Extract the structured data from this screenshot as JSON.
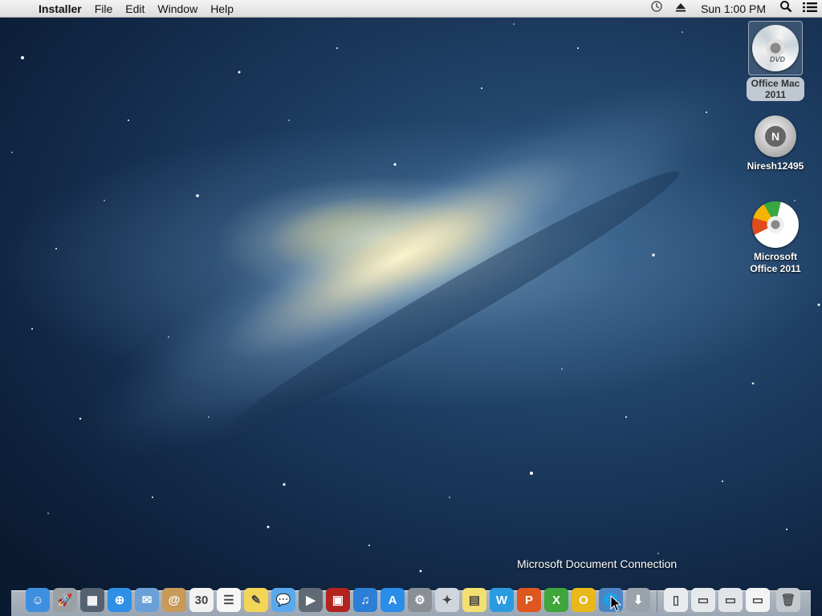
{
  "menubar": {
    "apple_glyph": "",
    "app_name": "Installer",
    "menus": [
      "File",
      "Edit",
      "Window",
      "Help"
    ],
    "clock": "Sun 1:00 PM",
    "status_icons": [
      "time-machine-icon",
      "eject-icon",
      "spotlight-search-icon",
      "notification-center-icon"
    ]
  },
  "desktop": {
    "icons": [
      {
        "label_line1": "Office Mac",
        "label_line2": "2011",
        "disc_text": "DVD",
        "selected": true
      },
      {
        "label": "Niresh12495",
        "badge": "N"
      },
      {
        "label_line1": "Microsoft",
        "label_line2": "Office 2011"
      }
    ]
  },
  "dock": {
    "tooltip": "Microsoft Document Connection",
    "items": [
      {
        "name": "finder-icon",
        "glyph": "☺",
        "bg": "#3d8fe0"
      },
      {
        "name": "launchpad-icon",
        "glyph": "🚀",
        "bg": "#9aa0a6"
      },
      {
        "name": "mission-control-icon",
        "glyph": "▦",
        "bg": "#556070"
      },
      {
        "name": "safari-icon",
        "glyph": "⊕",
        "bg": "#2f8fe6"
      },
      {
        "name": "mail-stamp-icon",
        "glyph": "✉",
        "bg": "#6aa0d8"
      },
      {
        "name": "contacts-icon",
        "glyph": "@",
        "bg": "#c79a5a"
      },
      {
        "name": "calendar-icon",
        "glyph": "30",
        "bg": "#f2f2f2"
      },
      {
        "name": "reminders-icon",
        "glyph": "☰",
        "bg": "#f7f7f7"
      },
      {
        "name": "notes-icon",
        "glyph": "✎",
        "bg": "#f3d558"
      },
      {
        "name": "messages-icon",
        "glyph": "💬",
        "bg": "#5aa9ec"
      },
      {
        "name": "facetime-icon",
        "glyph": "▶",
        "bg": "#606a74"
      },
      {
        "name": "photo-booth-icon",
        "glyph": "▣",
        "bg": "#b3241f"
      },
      {
        "name": "itunes-icon",
        "glyph": "♫",
        "bg": "#2b7fd6"
      },
      {
        "name": "app-store-icon",
        "glyph": "A",
        "bg": "#2a8de8"
      },
      {
        "name": "system-preferences-icon",
        "glyph": "⚙",
        "bg": "#8a8f96"
      },
      {
        "name": "automator-icon",
        "glyph": "✦",
        "bg": "#cfd6de"
      },
      {
        "name": "stickies-icon",
        "glyph": "▤",
        "bg": "#f3e070"
      },
      {
        "name": "word-icon",
        "glyph": "W",
        "bg": "#2a9be0"
      },
      {
        "name": "powerpoint-icon",
        "glyph": "P",
        "bg": "#e0561f"
      },
      {
        "name": "excel-icon",
        "glyph": "X",
        "bg": "#3ea63a"
      },
      {
        "name": "outlook-icon",
        "glyph": "O",
        "bg": "#e9b81a"
      },
      {
        "name": "document-connection-icon",
        "glyph": "🌐",
        "bg": "#4a86c6"
      },
      {
        "name": "downloads-icon",
        "glyph": "⬇",
        "bg": "#9aa3ab"
      }
    ],
    "right_items": [
      {
        "name": "document-stack-icon",
        "glyph": "▯",
        "bg": "#e9ecef"
      },
      {
        "name": "document-stack-2-icon",
        "glyph": "▭",
        "bg": "#e6e9ec"
      },
      {
        "name": "document-stack-3-icon",
        "glyph": "▭",
        "bg": "#e1e5ea"
      },
      {
        "name": "document-stack-4-icon",
        "glyph": "▭",
        "bg": "#f2f3f5"
      }
    ],
    "trash_glyph": "🗑"
  }
}
